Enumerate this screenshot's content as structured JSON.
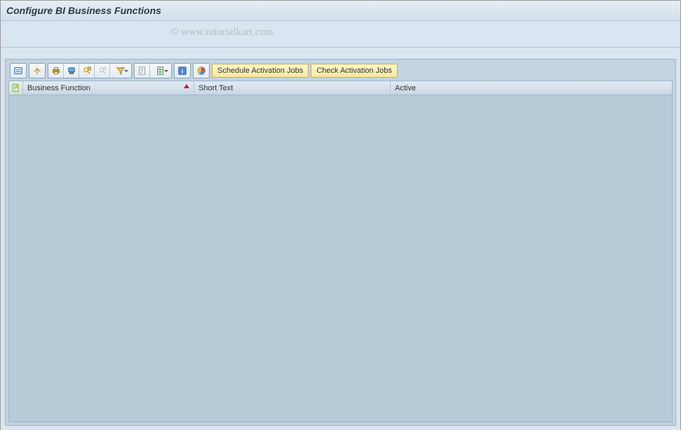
{
  "title": "Configure  BI Business Functions",
  "watermark": "© www.tutorialkart.com",
  "toolbar": {
    "buttons": {
      "details": "details-icon",
      "sort_asc": "sort-ascending-icon",
      "print": "print-icon",
      "print_preview": "print-preview-icon",
      "find": "find-icon",
      "find_next": "find-next-icon",
      "filter": "filter-icon",
      "export_text": "export-text-icon",
      "export_spreadsheet": "export-spreadsheet-icon",
      "info": "info-icon",
      "chart": "chart-icon"
    },
    "text_buttons": {
      "schedule": "Schedule Activation Jobs",
      "check": "Check Activation Jobs"
    }
  },
  "table": {
    "columns": {
      "business_function": "Business Function",
      "short_text": "Short Text",
      "active": "Active"
    },
    "rows": []
  }
}
